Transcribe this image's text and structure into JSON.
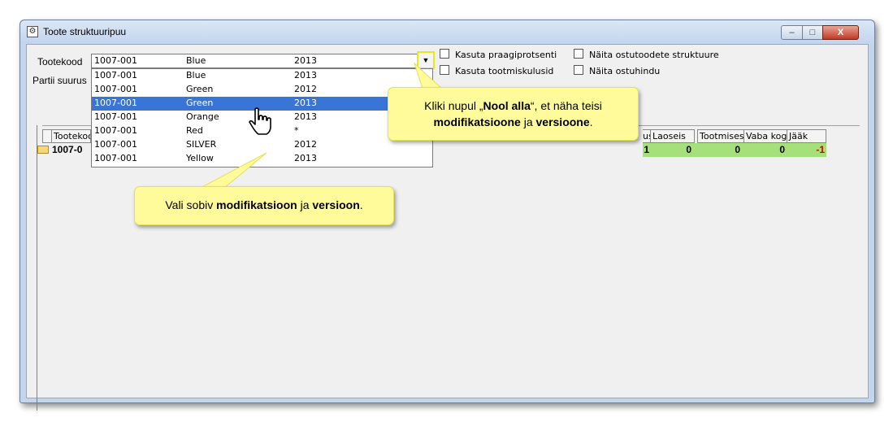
{
  "window": {
    "title": "Toote struktuuripuu",
    "min_label": "–",
    "max_label": "□",
    "close_label": "X"
  },
  "form": {
    "product_code_label": "Tootekood",
    "batch_size_label": "Partii suurus",
    "combo": {
      "code": "1007-001",
      "modification": "Blue",
      "version": "2013"
    },
    "dropdown_arrow": "▼",
    "checkboxes": [
      {
        "label": "Kasuta praagiprotsenti",
        "checked": false
      },
      {
        "label": "Kasuta tootmiskulusid",
        "checked": false
      },
      {
        "label": "Näita ostutoodete struktuure",
        "checked": false
      },
      {
        "label": "Näita ostuhindu",
        "checked": false
      }
    ]
  },
  "dropdown": {
    "rows": [
      {
        "code": "1007-001",
        "modification": "Blue",
        "version": "2013",
        "selected": false
      },
      {
        "code": "1007-001",
        "modification": "Green",
        "version": "2012",
        "selected": false
      },
      {
        "code": "1007-001",
        "modification": "Green",
        "version": "2013",
        "selected": true
      },
      {
        "code": "1007-001",
        "modification": "Orange",
        "version": "2013",
        "selected": false
      },
      {
        "code": "1007-001",
        "modification": "Red",
        "version": "*",
        "selected": false
      },
      {
        "code": "1007-001",
        "modification": "SILVER",
        "version": "2012",
        "selected": false
      },
      {
        "code": "1007-001",
        "modification": "Yellow",
        "version": "2013",
        "selected": false
      }
    ]
  },
  "grid": {
    "headers": [
      "Tootekood",
      "us",
      "Laoseis",
      "Tootmises",
      "Vaba kog",
      "Jääk"
    ],
    "row": {
      "code": "1007-0",
      "values": [
        "1",
        "0",
        "0",
        "0",
        "-1"
      ]
    }
  },
  "callouts": {
    "arrow_tip_pre": "Kliki nupul „",
    "arrow_tip_bold1": "Nool alla",
    "arrow_tip_mid": "“, et näha teisi",
    "arrow_tip_bold2": "modifikatsioone",
    "arrow_tip_and": " ja ",
    "arrow_tip_bold3": "versioone",
    "arrow_tip_end": ".",
    "select_tip_pre": "Vali sobiv ",
    "select_tip_bold1": "modifikatsioon",
    "select_tip_and": " ja ",
    "select_tip_bold2": "versioon",
    "select_tip_end": "."
  },
  "colors": {
    "selection": "#3875d7",
    "row_green": "#a6e07b",
    "callout_bg": "#fffb9a",
    "highlight_border": "#e5ea1a",
    "negative": "#d00000"
  },
  "icons": {
    "cursor": "hand-pointer-icon",
    "folder": "folder-icon"
  }
}
